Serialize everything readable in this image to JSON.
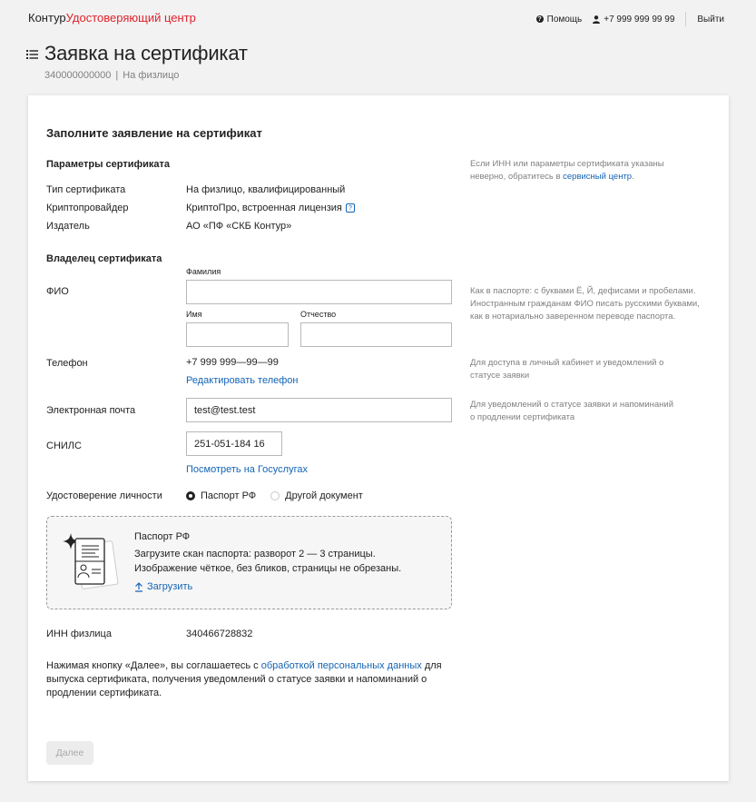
{
  "header": {
    "logo_brand": "Контур",
    "logo_product": "Удостоверяющий центр",
    "help": "Помощь",
    "phone": "+7 999 999 99 99",
    "logout": "Выйти"
  },
  "page": {
    "title": "Заявка на сертификат",
    "number": "340000000000",
    "type": "На физлицо"
  },
  "form": {
    "title": "Заполните заявление на сертификат",
    "params": {
      "heading": "Параметры сертификата",
      "hint_text": "Если ИНН или параметры сертификата указаны неверно, обратитесь в",
      "hint_link": "сервисный центр",
      "hint_end": ".",
      "rows": [
        {
          "label": "Тип сертификата",
          "value": "На физлицо, квалифицированный"
        },
        {
          "label": "Криптопровайдер",
          "value": "КриптоПро, встроенная лицензия"
        },
        {
          "label": "Издатель",
          "value": "АО «ПФ «СКБ Контур»"
        }
      ]
    },
    "owner": {
      "heading": "Владелец сертификата",
      "fio_label": "ФИО",
      "surname_label": "Фамилия",
      "surname_value": "",
      "name_label": "Имя",
      "name_value": "",
      "patronymic_label": "Отчество",
      "patronymic_value": "",
      "fio_hint": "Как в паспорте: с буквами Ё, Й, дефисами и пробелами. Иностранным гражданам ФИО писать русскими буквами, как в нотариально заверенном переводе паспорта.",
      "phone_label": "Телефон",
      "phone_value": "+7 999 999—99—99",
      "phone_edit": "Редактировать телефон",
      "phone_hint": "Для доступа в личный кабинет и уведомлений о статусе заявки",
      "email_label": "Электронная почта",
      "email_value": "test@test.test",
      "email_hint": "Для уведомлений о статусе заявки и напоминаний о продлении сертификата",
      "snils_label": "СНИЛС",
      "snils_value": "251-051-184 16",
      "snils_link": "Посмотреть на Госуслугах",
      "id_label": "Удостоверение личности",
      "id_options": [
        "Паспорт РФ",
        "Другой документ"
      ],
      "id_selected": "Паспорт РФ"
    },
    "upload": {
      "title": "Паспорт РФ",
      "line1": "Загрузите скан паспорта: разворот 2 — 3 страницы.",
      "line2": "Изображение чёткое, без бликов, страницы не обрезаны.",
      "action": "Загрузить"
    },
    "inn": {
      "label": "ИНН физлица",
      "value": "340466728832"
    },
    "consent": {
      "before": "Нажимая кнопку «Далее», вы соглашаетесь с",
      "link": "обработкой персональных данных",
      "after": "для выпуска сертификата, получения уведомлений о статусе заявки и напоминаний о продлении сертификата."
    },
    "next_button": "Далее"
  }
}
